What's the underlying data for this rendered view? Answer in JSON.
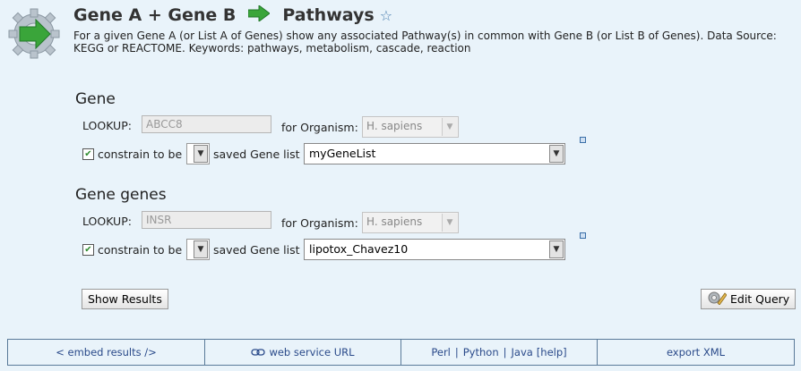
{
  "header": {
    "title_part1": "Gene A + Gene B",
    "title_part2": "Pathways",
    "description": "For a given Gene A (or List A of Genes) show any associated Pathway(s) in common with Gene B (or List B of Genes). Data Source: KEGG or REACTOME. Keywords: pathways, metabolism, cascade, reaction"
  },
  "constraint_a": {
    "title": "Gene",
    "lookup_label": "LOOKUP:",
    "lookup_value": "ABCC8",
    "organism_label": "for Organism:",
    "organism_value": "H. sapiens",
    "constrain_label": "constrain to be",
    "constrain_checked": true,
    "saved_list_label": "saved Gene list",
    "saved_list_value": "myGeneList"
  },
  "constraint_b": {
    "title": "Gene genes",
    "lookup_label": "LOOKUP:",
    "lookup_value": "INSR",
    "organism_label": "for Organism:",
    "organism_value": "H. sapiens",
    "constrain_label": "constrain to be",
    "constrain_checked": true,
    "saved_list_label": "saved Gene list",
    "saved_list_value": "lipotox_Chavez10"
  },
  "actions": {
    "show_results": "Show Results",
    "edit_query": "Edit Query"
  },
  "footer": {
    "embed": "< embed results />",
    "web_service": "web service URL",
    "perl": "Perl",
    "python": "Python",
    "java": "Java",
    "help": "[help]",
    "export": "export XML"
  },
  "colors": {
    "background": "#e9f3fa",
    "link": "#2a4a8a",
    "arrow_green": "#3aa53a"
  }
}
